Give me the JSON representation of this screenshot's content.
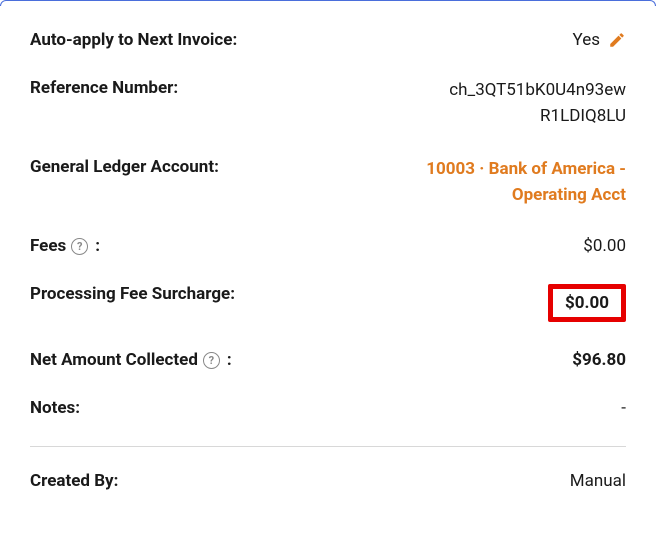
{
  "rows": {
    "auto_apply": {
      "label": "Auto-apply to Next Invoice:",
      "value": "Yes"
    },
    "reference": {
      "label": "Reference Number:",
      "value_line1": "ch_3QT51bK0U4n93ew",
      "value_line2": "R1LDIQ8LU"
    },
    "gl_account": {
      "label": "General Ledger Account:",
      "value": "10003 · Bank of America - Operating Acct"
    },
    "fees": {
      "label": "Fees",
      "value": "$0.00"
    },
    "surcharge": {
      "label": "Processing Fee Surcharge:",
      "value": "$0.00"
    },
    "net": {
      "label": "Net Amount Collected",
      "value": "$96.80"
    },
    "notes": {
      "label": "Notes:",
      "value": "-"
    },
    "created_by": {
      "label": "Created By:",
      "value": "Manual"
    }
  },
  "icons": {
    "help_glyph": "?"
  }
}
